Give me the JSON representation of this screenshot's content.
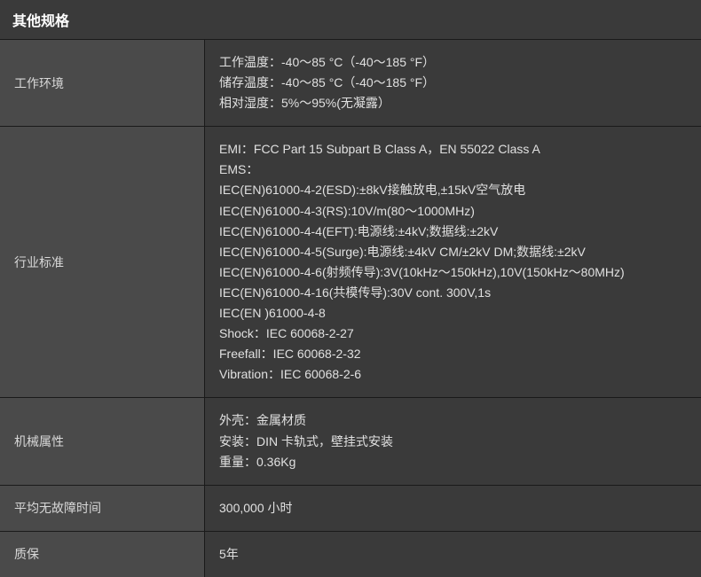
{
  "header": "其他规格",
  "rows": [
    {
      "label": "工作环境",
      "lines": [
        "工作温度：-40～85 °C（-40～185 °F）",
        "储存温度：-40～85 °C（-40～185 °F）",
        "相对湿度：5%～95%(无凝露）"
      ]
    },
    {
      "label": "行业标准",
      "lines": [
        "EMI：FCC Part 15 Subpart B Class A，EN 55022 Class A",
        "EMS：",
        "IEC(EN)61000-4-2(ESD):±8kV接触放电,±15kV空气放电",
        "IEC(EN)61000-4-3(RS):10V/m(80～1000MHz)",
        "IEC(EN)61000-4-4(EFT):电源线:±4kV;数据线:±2kV",
        "IEC(EN)61000-4-5(Surge):电源线:±4kV CM/±2kV DM;数据线:±2kV",
        "IEC(EN)61000-4-6(射频传导):3V(10kHz～150kHz),10V(150kHz～80MHz)",
        "IEC(EN)61000-4-16(共模传导):30V cont. 300V,1s",
        "IEC(EN )61000-4-8",
        "Shock：IEC 60068-2-27",
        "Freefall：IEC 60068-2-32",
        "Vibration：IEC 60068-2-6"
      ]
    },
    {
      "label": "机械属性",
      "lines": [
        "外壳：金属材质",
        "安装：DIN 卡轨式，壁挂式安装",
        "重量：0.36Kg"
      ]
    },
    {
      "label": "平均无故障时间",
      "lines": [
        "300,000 小时"
      ]
    },
    {
      "label": "质保",
      "lines": [
        "5年"
      ]
    }
  ]
}
